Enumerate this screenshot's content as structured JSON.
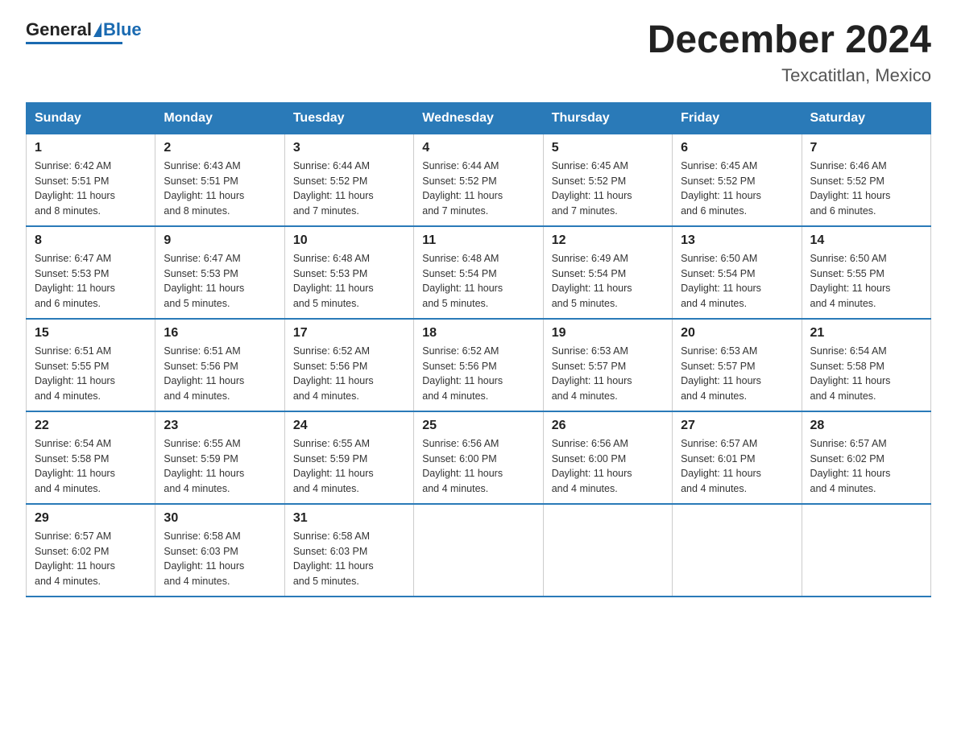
{
  "logo": {
    "text_general": "General",
    "text_blue": "Blue"
  },
  "header": {
    "title": "December 2024",
    "subtitle": "Texcatitlan, Mexico"
  },
  "weekdays": [
    "Sunday",
    "Monday",
    "Tuesday",
    "Wednesday",
    "Thursday",
    "Friday",
    "Saturday"
  ],
  "weeks": [
    [
      {
        "day": "1",
        "sunrise": "6:42 AM",
        "sunset": "5:51 PM",
        "daylight": "11 hours and 8 minutes."
      },
      {
        "day": "2",
        "sunrise": "6:43 AM",
        "sunset": "5:51 PM",
        "daylight": "11 hours and 8 minutes."
      },
      {
        "day": "3",
        "sunrise": "6:44 AM",
        "sunset": "5:52 PM",
        "daylight": "11 hours and 7 minutes."
      },
      {
        "day": "4",
        "sunrise": "6:44 AM",
        "sunset": "5:52 PM",
        "daylight": "11 hours and 7 minutes."
      },
      {
        "day": "5",
        "sunrise": "6:45 AM",
        "sunset": "5:52 PM",
        "daylight": "11 hours and 7 minutes."
      },
      {
        "day": "6",
        "sunrise": "6:45 AM",
        "sunset": "5:52 PM",
        "daylight": "11 hours and 6 minutes."
      },
      {
        "day": "7",
        "sunrise": "6:46 AM",
        "sunset": "5:52 PM",
        "daylight": "11 hours and 6 minutes."
      }
    ],
    [
      {
        "day": "8",
        "sunrise": "6:47 AM",
        "sunset": "5:53 PM",
        "daylight": "11 hours and 6 minutes."
      },
      {
        "day": "9",
        "sunrise": "6:47 AM",
        "sunset": "5:53 PM",
        "daylight": "11 hours and 5 minutes."
      },
      {
        "day": "10",
        "sunrise": "6:48 AM",
        "sunset": "5:53 PM",
        "daylight": "11 hours and 5 minutes."
      },
      {
        "day": "11",
        "sunrise": "6:48 AM",
        "sunset": "5:54 PM",
        "daylight": "11 hours and 5 minutes."
      },
      {
        "day": "12",
        "sunrise": "6:49 AM",
        "sunset": "5:54 PM",
        "daylight": "11 hours and 5 minutes."
      },
      {
        "day": "13",
        "sunrise": "6:50 AM",
        "sunset": "5:54 PM",
        "daylight": "11 hours and 4 minutes."
      },
      {
        "day": "14",
        "sunrise": "6:50 AM",
        "sunset": "5:55 PM",
        "daylight": "11 hours and 4 minutes."
      }
    ],
    [
      {
        "day": "15",
        "sunrise": "6:51 AM",
        "sunset": "5:55 PM",
        "daylight": "11 hours and 4 minutes."
      },
      {
        "day": "16",
        "sunrise": "6:51 AM",
        "sunset": "5:56 PM",
        "daylight": "11 hours and 4 minutes."
      },
      {
        "day": "17",
        "sunrise": "6:52 AM",
        "sunset": "5:56 PM",
        "daylight": "11 hours and 4 minutes."
      },
      {
        "day": "18",
        "sunrise": "6:52 AM",
        "sunset": "5:56 PM",
        "daylight": "11 hours and 4 minutes."
      },
      {
        "day": "19",
        "sunrise": "6:53 AM",
        "sunset": "5:57 PM",
        "daylight": "11 hours and 4 minutes."
      },
      {
        "day": "20",
        "sunrise": "6:53 AM",
        "sunset": "5:57 PM",
        "daylight": "11 hours and 4 minutes."
      },
      {
        "day": "21",
        "sunrise": "6:54 AM",
        "sunset": "5:58 PM",
        "daylight": "11 hours and 4 minutes."
      }
    ],
    [
      {
        "day": "22",
        "sunrise": "6:54 AM",
        "sunset": "5:58 PM",
        "daylight": "11 hours and 4 minutes."
      },
      {
        "day": "23",
        "sunrise": "6:55 AM",
        "sunset": "5:59 PM",
        "daylight": "11 hours and 4 minutes."
      },
      {
        "day": "24",
        "sunrise": "6:55 AM",
        "sunset": "5:59 PM",
        "daylight": "11 hours and 4 minutes."
      },
      {
        "day": "25",
        "sunrise": "6:56 AM",
        "sunset": "6:00 PM",
        "daylight": "11 hours and 4 minutes."
      },
      {
        "day": "26",
        "sunrise": "6:56 AM",
        "sunset": "6:00 PM",
        "daylight": "11 hours and 4 minutes."
      },
      {
        "day": "27",
        "sunrise": "6:57 AM",
        "sunset": "6:01 PM",
        "daylight": "11 hours and 4 minutes."
      },
      {
        "day": "28",
        "sunrise": "6:57 AM",
        "sunset": "6:02 PM",
        "daylight": "11 hours and 4 minutes."
      }
    ],
    [
      {
        "day": "29",
        "sunrise": "6:57 AM",
        "sunset": "6:02 PM",
        "daylight": "11 hours and 4 minutes."
      },
      {
        "day": "30",
        "sunrise": "6:58 AM",
        "sunset": "6:03 PM",
        "daylight": "11 hours and 4 minutes."
      },
      {
        "day": "31",
        "sunrise": "6:58 AM",
        "sunset": "6:03 PM",
        "daylight": "11 hours and 5 minutes."
      },
      null,
      null,
      null,
      null
    ]
  ],
  "labels": {
    "sunrise": "Sunrise:",
    "sunset": "Sunset:",
    "daylight": "Daylight:"
  }
}
